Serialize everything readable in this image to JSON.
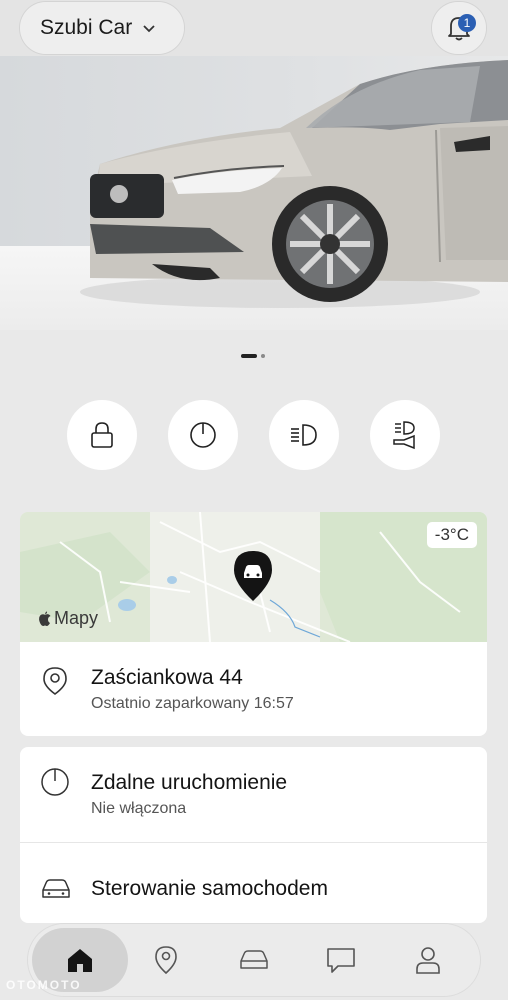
{
  "header": {
    "car_name": "Szubi Car",
    "notification_count": "1"
  },
  "hero": {
    "image": "silver-volvo-v90-front-three-quarter",
    "page_index": 1,
    "page_count": 2
  },
  "quick_actions": [
    {
      "icon": "lock-icon"
    },
    {
      "icon": "power-icon"
    },
    {
      "icon": "headlights-icon"
    },
    {
      "icon": "horn-lights-icon"
    }
  ],
  "map_card": {
    "temperature": "-3°C",
    "maps_label": "Mapy",
    "address": "Zaściankowa 44",
    "parked_status": "Ostatnio zaparkowany 16:57"
  },
  "actions": {
    "remote_start_title": "Zdalne uruchomienie",
    "remote_start_status": "Nie włączona",
    "car_control_title": "Sterowanie samochodem"
  },
  "nav": [
    "home-icon",
    "location-icon",
    "car-icon",
    "chat-icon",
    "profile-icon"
  ],
  "watermark": "OTOMOTO",
  "colors": {
    "badge": "#2b5fb3",
    "background": "#e9e9e9",
    "card": "#ffffff"
  }
}
